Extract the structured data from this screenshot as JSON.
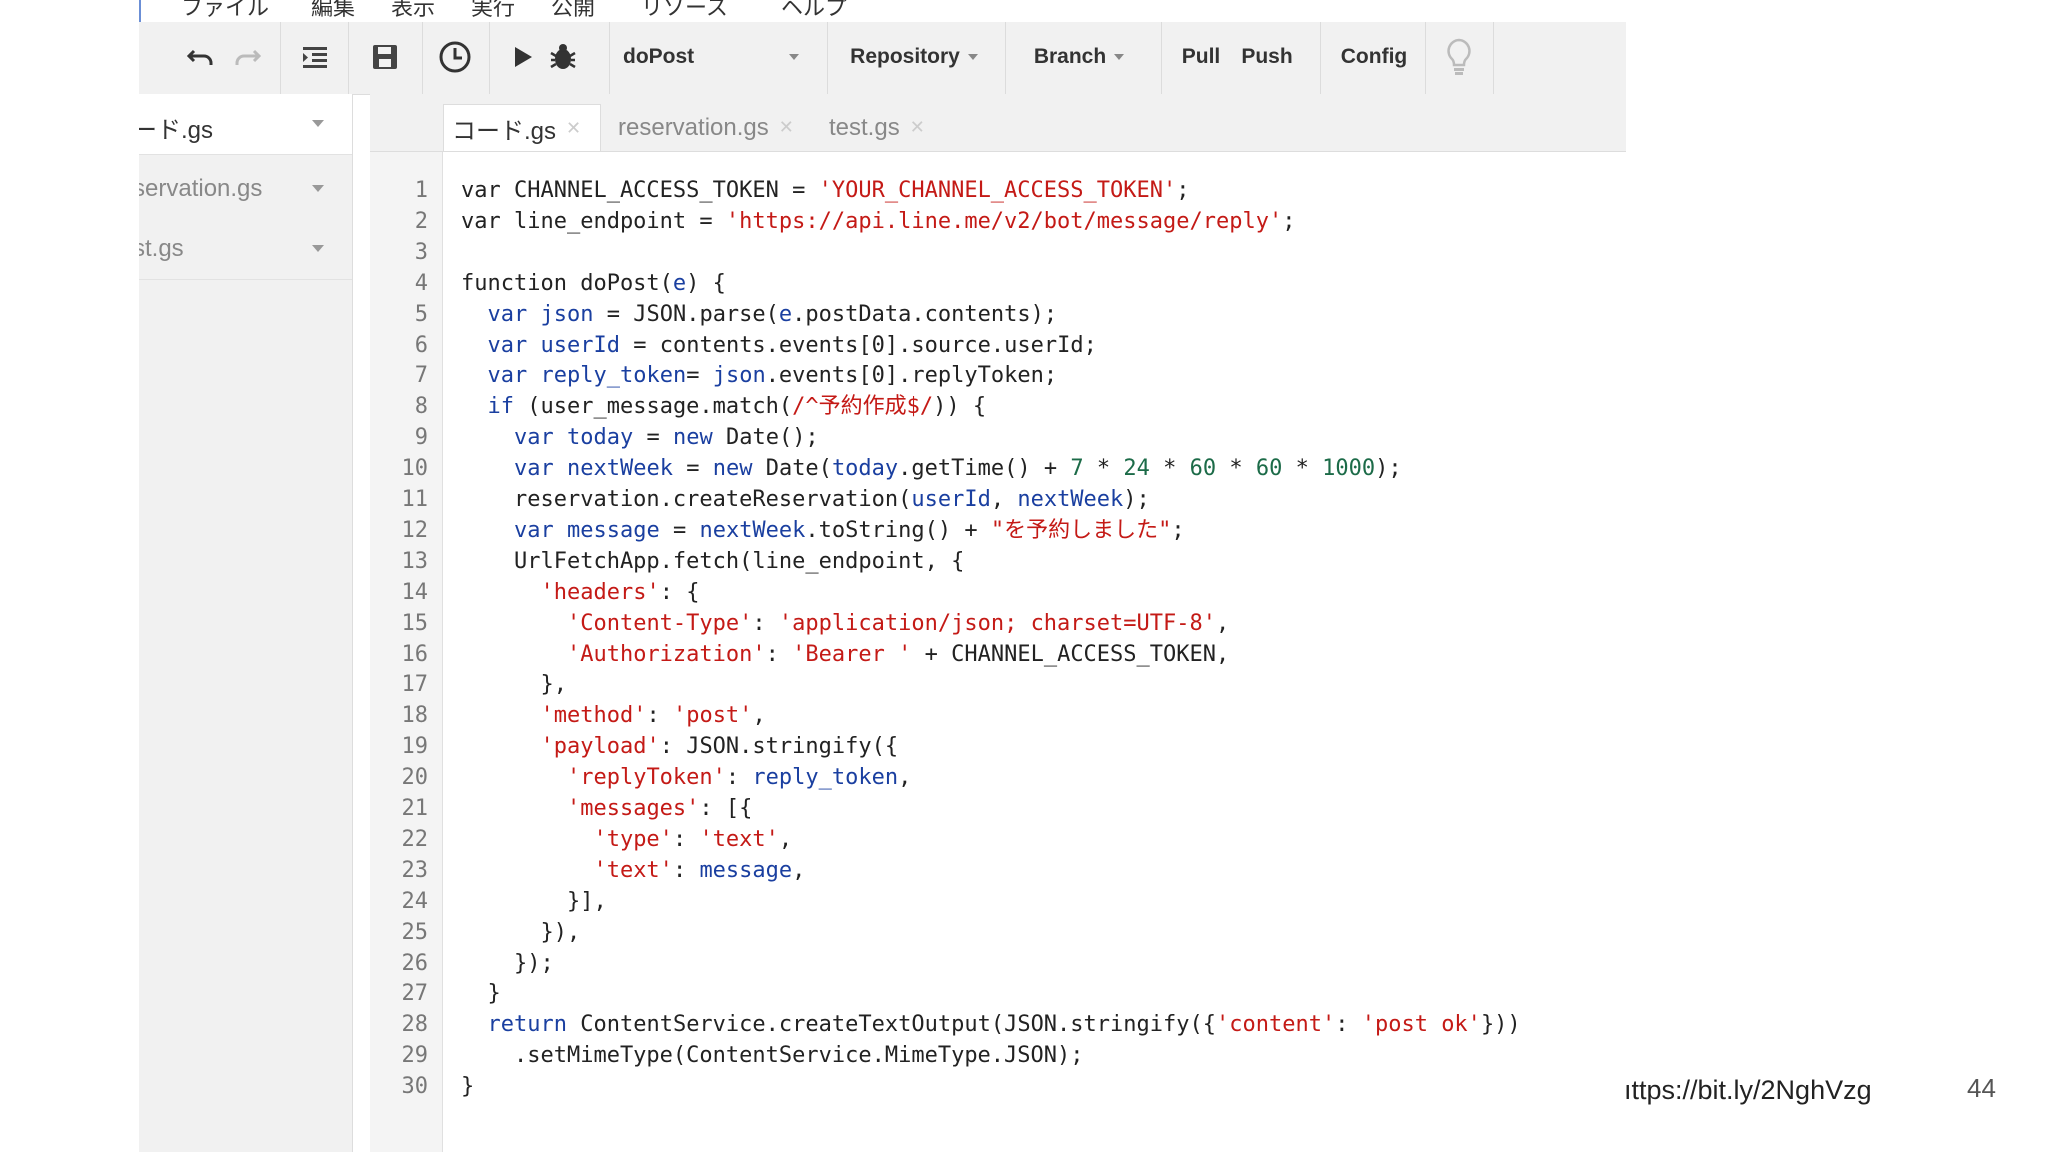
{
  "menu": [
    "ファイル",
    "編集",
    "表示",
    "実行",
    "公開",
    "リソース",
    "ヘルプ"
  ],
  "toolbar": {
    "function_select": "doPost",
    "repository": "Repository",
    "branch": "Branch",
    "pull": "Pull",
    "push": "Push",
    "config": "Config",
    "icons": [
      "undo-icon",
      "redo-icon",
      "indent-icon",
      "save-icon",
      "clock-icon",
      "run-icon",
      "debug-icon",
      "lightbulb-icon"
    ]
  },
  "sidebar": {
    "files": [
      {
        "label": "ード.gs",
        "active": true
      },
      {
        "label": "servation.gs",
        "active": false
      },
      {
        "label": "st.gs",
        "active": false
      }
    ]
  },
  "tabs": [
    {
      "label": "コード.gs",
      "active": true
    },
    {
      "label": "reservation.gs",
      "active": false
    },
    {
      "label": "test.gs",
      "active": false
    }
  ],
  "code": [
    {
      "n": "1",
      "html": "<span style='color:#222'>var CHANNEL_ACCESS_TOKEN = </span><span style='color:#c41a16'>'YOUR_CHANNEL_ACCESS_TOKEN'</span>;"
    },
    {
      "n": "2",
      "html": "var line_endpoint = <span style='color:#c41a16'>'https://api.line.me/v2/bot/message/reply'</span>;"
    },
    {
      "n": "3",
      "html": ""
    },
    {
      "n": "4",
      "html": "function doPost(<span style='color:#1a3fa0'>e</span>) {"
    },
    {
      "n": "5",
      "html": "  <span style='color:#1a3fa0'>var</span> <span style='color:#1a3fa0'>json</span> = JSON.parse(<span style='color:#1a3fa0'>e</span>.postData.contents);"
    },
    {
      "n": "6",
      "html": "  <span style='color:#1a3fa0'>var</span> <span style='color:#1a3fa0'>userId</span> = contents.events[0].source.userId;"
    },
    {
      "n": "7",
      "html": "  <span style='color:#1a3fa0'>var</span> <span style='color:#1a3fa0'>reply_token</span>= <span style='color:#1a3fa0'>json</span>.events[0].replyToken;"
    },
    {
      "n": "8",
      "html": "  <span style='color:#1a3fa0'>if</span> (user_message.match(<span style='color:#c41a16'>/^予約作成$/</span>)) {"
    },
    {
      "n": "9",
      "html": "    <span style='color:#1a3fa0'>var</span> <span style='color:#1a3fa0'>today</span> = <span style='color:#1a3fa0'>new</span> Date();"
    },
    {
      "n": "10",
      "html": "    <span style='color:#1a3fa0'>var</span> <span style='color:#1a3fa0'>nextWeek</span> = <span style='color:#1a3fa0'>new</span> Date(<span style='color:#1a3fa0'>today</span>.getTime() + <span style='color:#1c6b48'>7</span> * <span style='color:#1c6b48'>24</span> * <span style='color:#1c6b48'>60</span> * <span style='color:#1c6b48'>60</span> * <span style='color:#1c6b48'>1000</span>);"
    },
    {
      "n": "11",
      "html": "    reservation.createReservation(<span style='color:#1a3fa0'>userId</span>, <span style='color:#1a3fa0'>nextWeek</span>);"
    },
    {
      "n": "12",
      "html": "    <span style='color:#1a3fa0'>var</span> <span style='color:#1a3fa0'>message</span> = <span style='color:#1a3fa0'>nextWeek</span>.toString() + <span style='color:#c41a16'>\"を予約しました\"</span>;"
    },
    {
      "n": "13",
      "html": "    UrlFetchApp.fetch(line_endpoint, {"
    },
    {
      "n": "14",
      "html": "      <span style='color:#c41a16'>'headers'</span>: {"
    },
    {
      "n": "15",
      "html": "        <span style='color:#c41a16'>'Content-Type'</span>: <span style='color:#c41a16'>'application/json; charset=UTF-8'</span>,"
    },
    {
      "n": "16",
      "html": "        <span style='color:#c41a16'>'Authorization'</span>: <span style='color:#c41a16'>'Bearer '</span> + CHANNEL_ACCESS_TOKEN,"
    },
    {
      "n": "17",
      "html": "      },"
    },
    {
      "n": "18",
      "html": "      <span style='color:#c41a16'>'method'</span>: <span style='color:#c41a16'>'post'</span>,"
    },
    {
      "n": "19",
      "html": "      <span style='color:#c41a16'>'payload'</span>: JSON.stringify({"
    },
    {
      "n": "20",
      "html": "        <span style='color:#c41a16'>'replyToken'</span>: <span style='color:#1a3fa0'>reply_token</span>,"
    },
    {
      "n": "21",
      "html": "        <span style='color:#c41a16'>'messages'</span>: [{"
    },
    {
      "n": "22",
      "html": "          <span style='color:#c41a16'>'type'</span>: <span style='color:#c41a16'>'text'</span>,"
    },
    {
      "n": "23",
      "html": "          <span style='color:#c41a16'>'text'</span>: <span style='color:#1a3fa0'>message</span>,"
    },
    {
      "n": "24",
      "html": "        }],"
    },
    {
      "n": "25",
      "html": "      }),"
    },
    {
      "n": "26",
      "html": "    });"
    },
    {
      "n": "27",
      "html": "  }"
    },
    {
      "n": "28",
      "html": "  <span style='color:#1a3fa0'>return</span> ContentService.createTextOutput(JSON.stringify({<span style='color:#c41a16'>'content'</span>: <span style='color:#c41a16'>'post ok'</span>}))"
    },
    {
      "n": "29",
      "html": "    .setMimeType(ContentService.MimeType.JSON);"
    },
    {
      "n": "30",
      "html": "}"
    }
  ],
  "footer": {
    "url": "ıttps://bit.ly/2NghVzg",
    "page_number": "44"
  }
}
